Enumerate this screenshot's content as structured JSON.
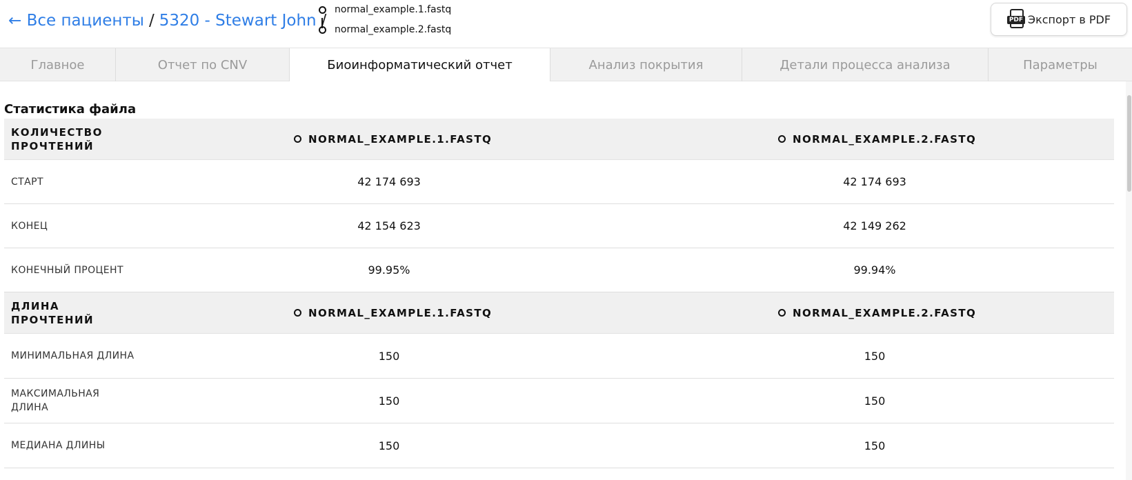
{
  "breadcrumb": {
    "back_link": "← Все пациенты",
    "sep1": "/",
    "patient": "5320 - Stewart John",
    "sep2": "/",
    "files": [
      "normal_example.1.fastq",
      "normal_example.2.fastq"
    ]
  },
  "export": {
    "label": "Экспорт в PDF",
    "icon_text": "PDF"
  },
  "tabs": [
    {
      "label": "Главное",
      "active": false
    },
    {
      "label": "Отчет по CNV",
      "active": false
    },
    {
      "label": "Биоинформатический отчет",
      "active": true
    },
    {
      "label": "Анализ покрытия",
      "active": false
    },
    {
      "label": "Детали процесса анализа",
      "active": false
    },
    {
      "label": "Параметры",
      "active": false
    }
  ],
  "section": {
    "title": "Статистика файла",
    "groups": [
      {
        "title": "КОЛИЧЕСТВО ПРОЧТЕНИЙ",
        "columns": [
          "NORMAL_EXAMPLE.1.FASTQ",
          "NORMAL_EXAMPLE.2.FASTQ"
        ],
        "rows": [
          {
            "label": "СТАРТ",
            "values": [
              "42 174 693",
              "42 174 693"
            ]
          },
          {
            "label": "КОНЕЦ",
            "values": [
              "42 154 623",
              "42 149 262"
            ]
          },
          {
            "label": "КОНЕЧНЫЙ ПРОЦЕНТ",
            "values": [
              "99.95%",
              "99.94%"
            ]
          }
        ]
      },
      {
        "title": "ДЛИНА ПРОЧТЕНИЙ",
        "columns": [
          "NORMAL_EXAMPLE.1.FASTQ",
          "NORMAL_EXAMPLE.2.FASTQ"
        ],
        "rows": [
          {
            "label": "МИНИМАЛЬНАЯ ДЛИНА",
            "values": [
              "150",
              "150"
            ]
          },
          {
            "label": "МАКСИМАЛЬНАЯ ДЛИНА",
            "values": [
              "150",
              "150"
            ]
          },
          {
            "label": "МЕДИАНА ДЛИНЫ",
            "values": [
              "150",
              "150"
            ]
          }
        ]
      }
    ]
  },
  "colors": {
    "link": "#2f7ee6",
    "tab_bg": "#f1f1f1",
    "group_header_bg": "#f0f0f0"
  }
}
